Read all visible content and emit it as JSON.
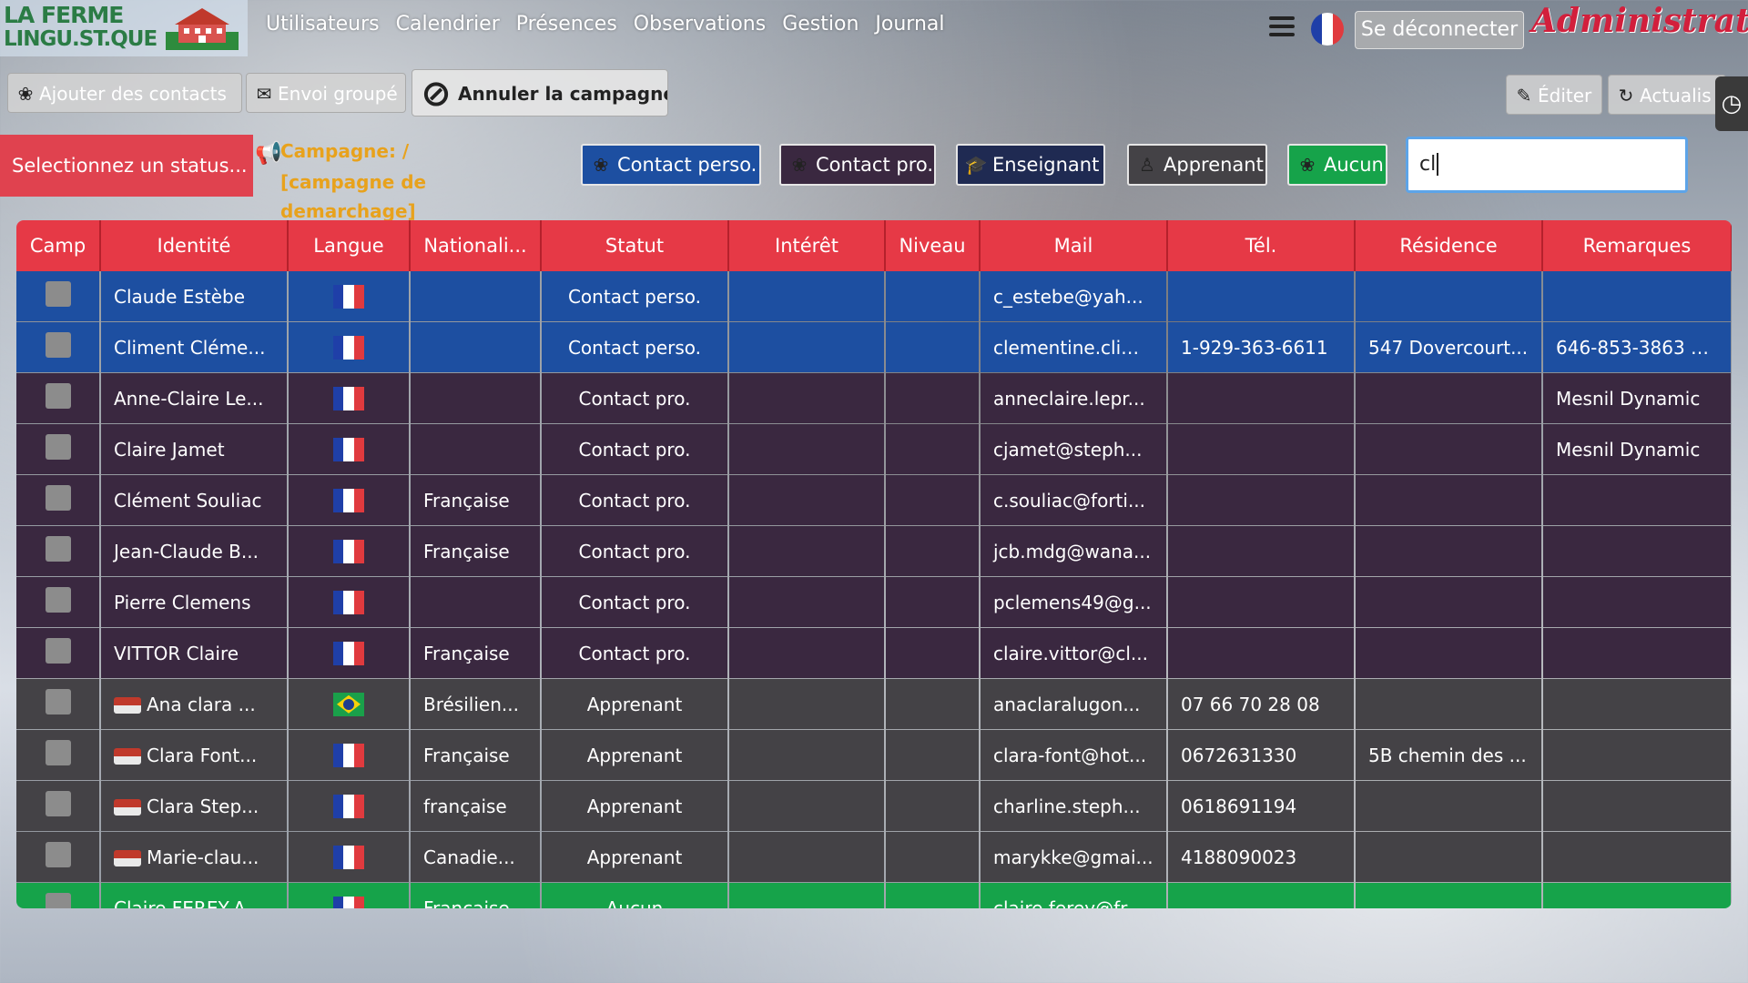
{
  "logo": {
    "line1": "LA FERME",
    "line2": "LINGU.ST.QUE"
  },
  "nav": {
    "items": [
      "Utilisateurs",
      "Calendrier",
      "Présences",
      "Observations",
      "Gestion",
      "Journal"
    ]
  },
  "header": {
    "logout_label": "Se déconnecter",
    "role": "Administrateur"
  },
  "actions": {
    "add_contacts": "Ajouter des contacts",
    "bulk_send": "Envoi groupé",
    "cancel_campaign": "Annuler la campagne",
    "edit": "Éditer",
    "refresh": "Actualis"
  },
  "status_select": {
    "placeholder": "Selectionnez un status..."
  },
  "campaign": {
    "line1": "Campagne:  /",
    "line2": "[campagne de demarchage]"
  },
  "filters": {
    "perso": "Contact perso.",
    "pro": "Contact pro.",
    "teacher": "Enseignant",
    "learner": "Apprenant",
    "none": "Aucun"
  },
  "search": {
    "value": "cl"
  },
  "colors": {
    "perso": "#1d4fa1",
    "pro": "#3a2840",
    "learner": "#444246",
    "none": "#16a34a",
    "header": "#e63946"
  },
  "table": {
    "headers": [
      "Camp",
      "Identité",
      "Langue",
      "Nationali...",
      "Statut",
      "Intérêt",
      "Niveau",
      "Mail",
      "Tél.",
      "Résidence",
      "Remarques"
    ],
    "rows": [
      {
        "kind": "perso",
        "identity": "Claude Estèbe",
        "flag": "fr",
        "nationality": "",
        "status": "Contact perso.",
        "interest": "",
        "level": "",
        "mail": "c_estebe@yah...",
        "tel": "",
        "residence": "",
        "remarks": "",
        "logo": false
      },
      {
        "kind": "perso",
        "identity": "Climent Cléme...",
        "flag": "fr",
        "nationality": "",
        "status": "Contact perso.",
        "interest": "",
        "level": "",
        "mail": "clementine.clim...",
        "tel": "1-929-363-6611",
        "residence": "547 Dovercourt...",
        "remarks": "646-853-3863 1-...",
        "logo": false
      },
      {
        "kind": "pro",
        "identity": "Anne-Claire Le...",
        "flag": "fr",
        "nationality": "",
        "status": "Contact pro.",
        "interest": "",
        "level": "",
        "mail": "anneclaire.lepr...",
        "tel": "",
        "residence": "",
        "remarks": "Mesnil Dynamic",
        "logo": false
      },
      {
        "kind": "pro",
        "identity": "Claire Jamet",
        "flag": "fr",
        "nationality": "",
        "status": "Contact pro.",
        "interest": "",
        "level": "",
        "mail": "cjamet@steph...",
        "tel": "",
        "residence": "",
        "remarks": "Mesnil Dynamic",
        "logo": false
      },
      {
        "kind": "pro",
        "identity": "Clément Souliac",
        "flag": "fr",
        "nationality": "Française",
        "status": "Contact pro.",
        "interest": "",
        "level": "",
        "mail": "c.souliac@forti...",
        "tel": "",
        "residence": "",
        "remarks": "",
        "logo": false
      },
      {
        "kind": "pro",
        "identity": "Jean-Claude B...",
        "flag": "fr",
        "nationality": "Française",
        "status": "Contact pro.",
        "interest": "",
        "level": "",
        "mail": "jcb.mdg@wana...",
        "tel": "",
        "residence": "",
        "remarks": "",
        "logo": false
      },
      {
        "kind": "pro",
        "identity": "Pierre Clemens",
        "flag": "fr",
        "nationality": "",
        "status": "Contact pro.",
        "interest": "",
        "level": "",
        "mail": "pclemens49@g...",
        "tel": "",
        "residence": "",
        "remarks": "",
        "logo": false
      },
      {
        "kind": "pro",
        "identity": "VITTOR Claire",
        "flag": "fr",
        "nationality": "Française",
        "status": "Contact pro.",
        "interest": "",
        "level": "",
        "mail": "claire.vittor@cl...",
        "tel": "",
        "residence": "",
        "remarks": "",
        "logo": false
      },
      {
        "kind": "appr",
        "identity": "Ana clara ...",
        "flag": "br",
        "nationality": "Brésilien...",
        "status": "Apprenant",
        "interest": "",
        "level": "",
        "mail": "anaclaralugon...",
        "tel": "07 66 70 28 08",
        "residence": "",
        "remarks": "",
        "logo": true
      },
      {
        "kind": "appr",
        "identity": "Clara Font...",
        "flag": "fr",
        "nationality": "Française",
        "status": "Apprenant",
        "interest": "",
        "level": "",
        "mail": "clara-font@hot...",
        "tel": "0672631330",
        "residence": "5B chemin des ...",
        "remarks": "",
        "logo": true
      },
      {
        "kind": "appr",
        "identity": "Clara Step...",
        "flag": "fr",
        "nationality": "française",
        "status": "Apprenant",
        "interest": "",
        "level": "",
        "mail": "charline.steph...",
        "tel": "0618691194",
        "residence": "",
        "remarks": "",
        "logo": true
      },
      {
        "kind": "appr",
        "identity": "Marie-clau...",
        "flag": "fr",
        "nationality": "Canadie...",
        "status": "Apprenant",
        "interest": "",
        "level": "",
        "mail": "marykke@gmai...",
        "tel": "4188090023",
        "residence": "",
        "remarks": "",
        "logo": true
      },
      {
        "kind": "none",
        "identity": "Claire FEREY-A...",
        "flag": "fr",
        "nationality": "Française",
        "status": "Aucun",
        "interest": "",
        "level": "",
        "mail": "claire.ferey@fr...",
        "tel": "",
        "residence": "",
        "remarks": "",
        "logo": false
      }
    ]
  }
}
